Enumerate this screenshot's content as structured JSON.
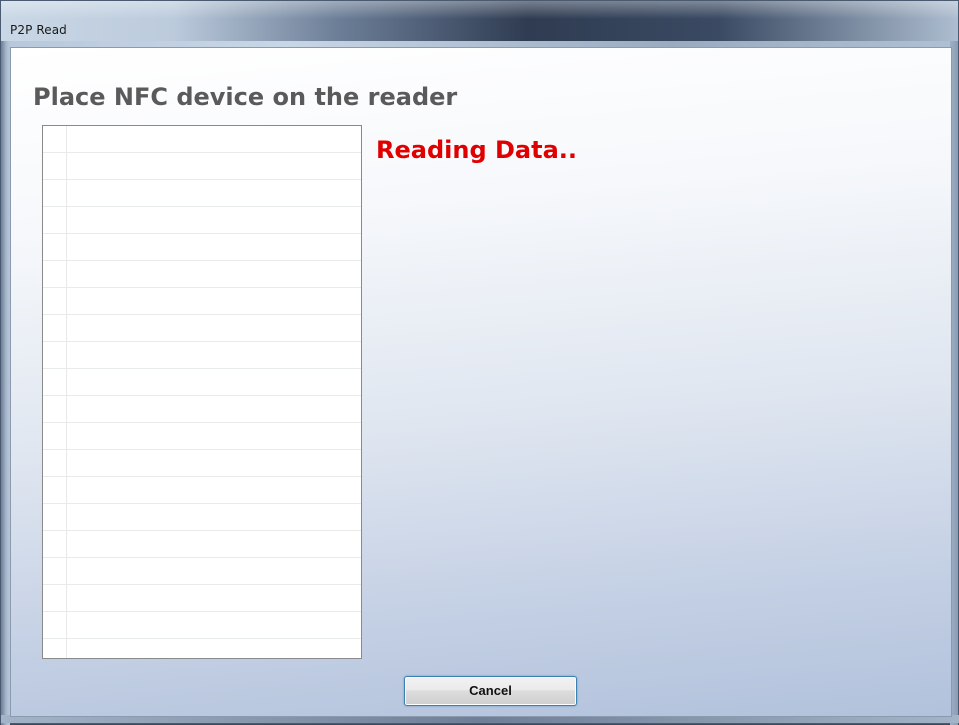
{
  "window": {
    "title": "P2P Read"
  },
  "main": {
    "heading": "Place NFC device on the reader",
    "status": "Reading Data..",
    "status_color": "#e00000",
    "list_items": []
  },
  "buttons": {
    "cancel_label": "Cancel"
  }
}
